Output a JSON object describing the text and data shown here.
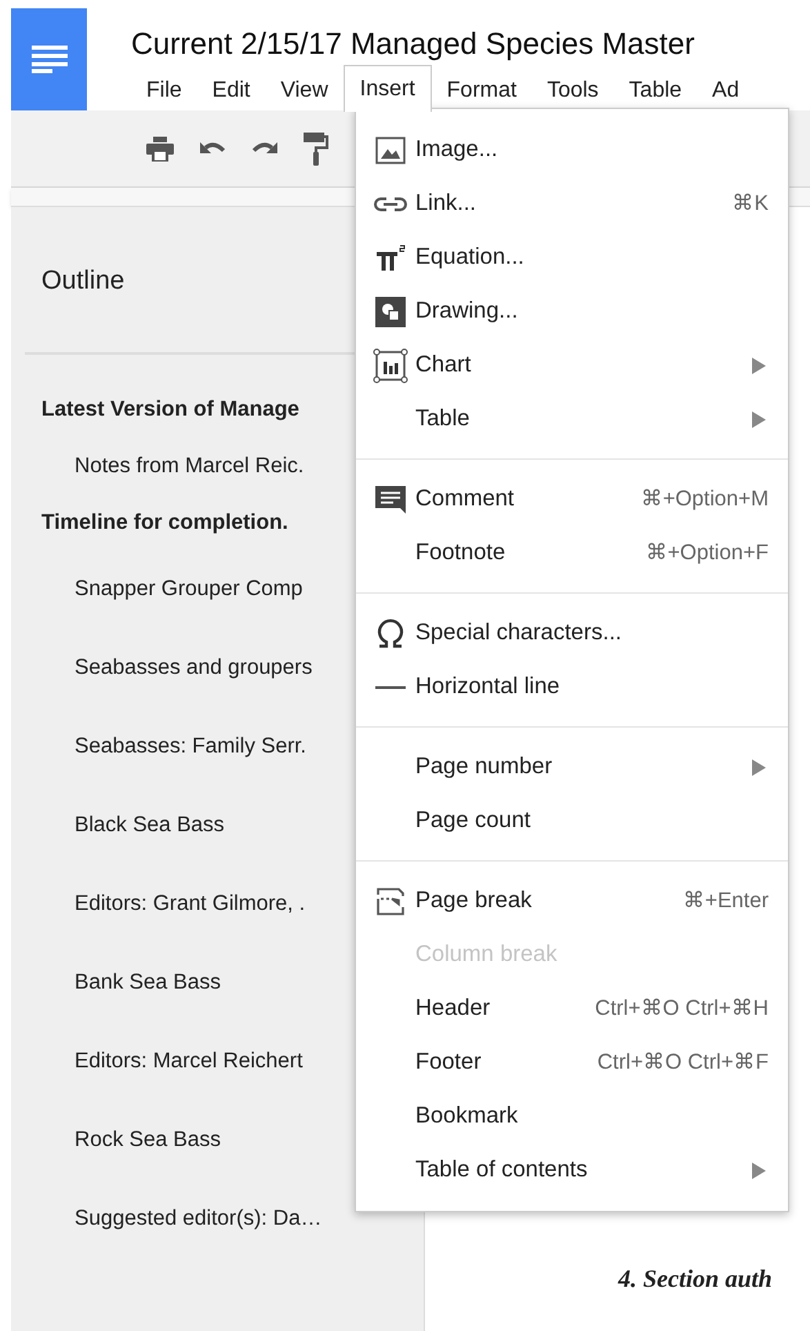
{
  "title": "Current 2/15/17 Managed Species Master",
  "menubar": [
    {
      "label": "File",
      "selected": false
    },
    {
      "label": "Edit",
      "selected": false
    },
    {
      "label": "View",
      "selected": false
    },
    {
      "label": "Insert",
      "selected": true
    },
    {
      "label": "Format",
      "selected": false
    },
    {
      "label": "Tools",
      "selected": false
    },
    {
      "label": "Table",
      "selected": false
    },
    {
      "label": "Ad",
      "selected": false
    }
  ],
  "outline": {
    "title": "Outline",
    "items": [
      {
        "label": "Latest Version of Manage",
        "children": [
          {
            "label": "Notes from Marcel Reic."
          }
        ]
      },
      {
        "label": "Timeline for completion.",
        "children": [
          {
            "label": "Snapper Grouper Comp"
          },
          {
            "label": "Seabasses and groupers"
          },
          {
            "label": "Seabasses: Family Serr."
          },
          {
            "label": "Black Sea Bass"
          },
          {
            "label": "Editors: Grant Gilmore, ."
          },
          {
            "label": "Bank Sea Bass"
          },
          {
            "label": "Editors: Marcel Reichert"
          },
          {
            "label": "Rock Sea Bass"
          },
          {
            "label": "Suggested editor(s): Da…"
          }
        ]
      }
    ]
  },
  "document": {
    "heading": "4.  Section auth"
  },
  "insert_menu": [
    [
      {
        "label": "Image...",
        "disabled": false,
        "submenu": false
      },
      {
        "label": "Link...",
        "shortcut": "⌘K",
        "disabled": false,
        "submenu": false
      },
      {
        "label": "Equation...",
        "disabled": false,
        "submenu": false
      },
      {
        "label": "Drawing...",
        "disabled": false,
        "submenu": false
      },
      {
        "label": "Chart",
        "disabled": false,
        "submenu": true
      },
      {
        "label": "Table",
        "disabled": false,
        "submenu": true
      }
    ],
    [
      {
        "label": "Comment",
        "shortcut": "⌘+Option+M",
        "disabled": false,
        "submenu": false
      },
      {
        "label": "Footnote",
        "shortcut": "⌘+Option+F",
        "disabled": false,
        "submenu": false
      }
    ],
    [
      {
        "label": "Special characters...",
        "disabled": false,
        "submenu": false
      },
      {
        "label": "Horizontal line",
        "disabled": false,
        "submenu": false
      }
    ],
    [
      {
        "label": "Page number",
        "disabled": false,
        "submenu": true
      },
      {
        "label": "Page count",
        "disabled": false,
        "submenu": false
      }
    ],
    [
      {
        "label": "Page break",
        "shortcut": "⌘+Enter",
        "disabled": false,
        "submenu": false
      },
      {
        "label": "Column break",
        "disabled": true,
        "submenu": false
      },
      {
        "label": "Header",
        "shortcut": "Ctrl+⌘O Ctrl+⌘H",
        "disabled": false,
        "submenu": false
      },
      {
        "label": "Footer",
        "shortcut": "Ctrl+⌘O Ctrl+⌘F",
        "disabled": false,
        "submenu": false
      },
      {
        "label": "Bookmark",
        "disabled": false,
        "submenu": false
      },
      {
        "label": "Table of contents",
        "disabled": false,
        "submenu": true
      }
    ]
  ]
}
